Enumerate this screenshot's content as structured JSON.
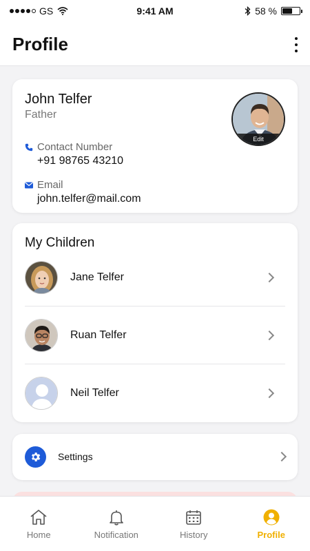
{
  "status_bar": {
    "carrier": "GS",
    "time": "9:41 AM",
    "battery_text": "58 %",
    "battery_level": 0.58
  },
  "header": {
    "title": "Profile"
  },
  "profile": {
    "name": "John Telfer",
    "role": "Father",
    "avatar_edit_label": "Edit",
    "contact_label": "Contact Number",
    "contact_value": "+91 98765 43210",
    "email_label": "Email",
    "email_value": "john.telfer@mail.com"
  },
  "children": {
    "title": "My Children",
    "items": [
      {
        "name": "Jane Telfer",
        "avatar": "girl-photo"
      },
      {
        "name": "Ruan Telfer",
        "avatar": "boy-photo"
      },
      {
        "name": "Neil Telfer",
        "avatar": "placeholder-silhouette"
      }
    ]
  },
  "settings": {
    "label": "Settings",
    "icon": "gear-icon"
  },
  "tabs": [
    {
      "label": "Home",
      "icon": "home-icon",
      "active": false
    },
    {
      "label": "Notification",
      "icon": "bell-icon",
      "active": false
    },
    {
      "label": "History",
      "icon": "calendar-icon",
      "active": false
    },
    {
      "label": "Profile",
      "icon": "user-icon",
      "active": true
    }
  ],
  "colors": {
    "accent": "#f0b000",
    "primary_blue": "#1e5bd8",
    "logout_tint": "#fbe0e0"
  }
}
